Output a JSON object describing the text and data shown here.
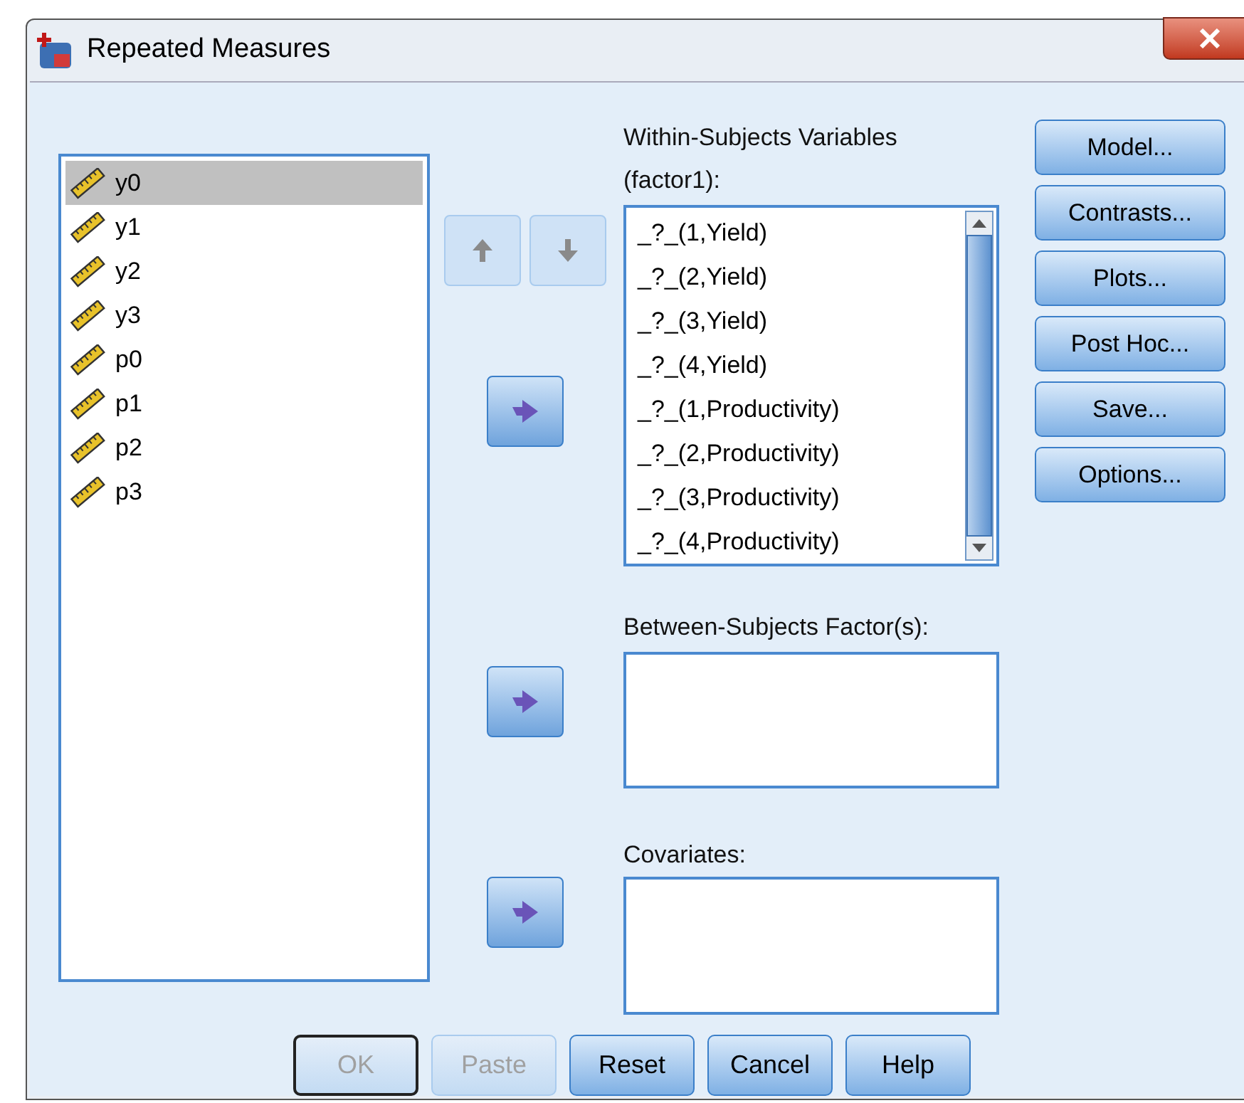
{
  "window": {
    "title": "Repeated Measures"
  },
  "variables": [
    {
      "name": "y0",
      "selected": true
    },
    {
      "name": "y1",
      "selected": false
    },
    {
      "name": "y2",
      "selected": false
    },
    {
      "name": "y3",
      "selected": false
    },
    {
      "name": "p0",
      "selected": false
    },
    {
      "name": "p1",
      "selected": false
    },
    {
      "name": "p2",
      "selected": false
    },
    {
      "name": "p3",
      "selected": false
    }
  ],
  "order_buttons": [
    {
      "kind": "up",
      "disabled": true
    },
    {
      "kind": "down",
      "disabled": true
    }
  ],
  "within": {
    "label": "Within-Subjects Variables",
    "sublabel": "(factor1):",
    "items": [
      "_?_(1,Yield)",
      "_?_(2,Yield)",
      "_?_(3,Yield)",
      "_?_(4,Yield)",
      "_?_(1,Productivity)",
      "_?_(2,Productivity)",
      "_?_(3,Productivity)",
      "_?_(4,Productivity)"
    ]
  },
  "between": {
    "label": "Between-Subjects Factor(s):"
  },
  "covariates": {
    "label": "Covariates:"
  },
  "side_buttons": [
    "Model...",
    "Contrasts...",
    "Plots...",
    "Post Hoc...",
    "Save...",
    "Options..."
  ],
  "bottom_buttons": [
    {
      "label": "OK",
      "disabled": true,
      "default": true
    },
    {
      "label": "Paste",
      "disabled": true,
      "default": false
    },
    {
      "label": "Reset",
      "disabled": false,
      "default": false
    },
    {
      "label": "Cancel",
      "disabled": false,
      "default": false
    },
    {
      "label": "Help",
      "disabled": false,
      "default": false
    }
  ]
}
